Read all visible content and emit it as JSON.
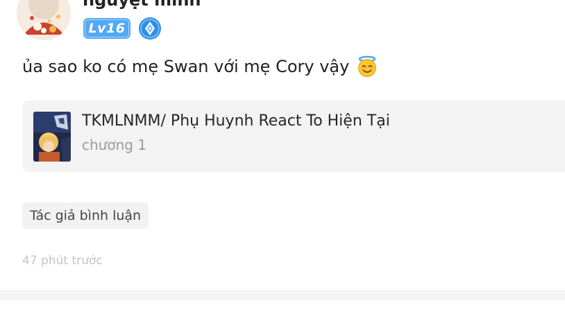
{
  "comment": {
    "username": "nguyệt minh",
    "level_label": "Lv16",
    "text": "ủa sao ko có mẹ Swan với mẹ Cory vậy",
    "emoji": "smiling-face-with-halo",
    "story": {
      "title": "TKMLNMM/ Phụ Huynh React To Hiện Tại",
      "chapter": "chương 1"
    },
    "author_tag": "Tác giả bình luận",
    "timestamp": "47 phút trước"
  },
  "colors": {
    "level_badge": "#52a8f5",
    "card_background": "#f3f3f3",
    "timestamp": "#c4c4c4"
  },
  "icons": {
    "rank": "diamond-rank-icon",
    "emoji": "halo-smile-emoji-icon"
  }
}
